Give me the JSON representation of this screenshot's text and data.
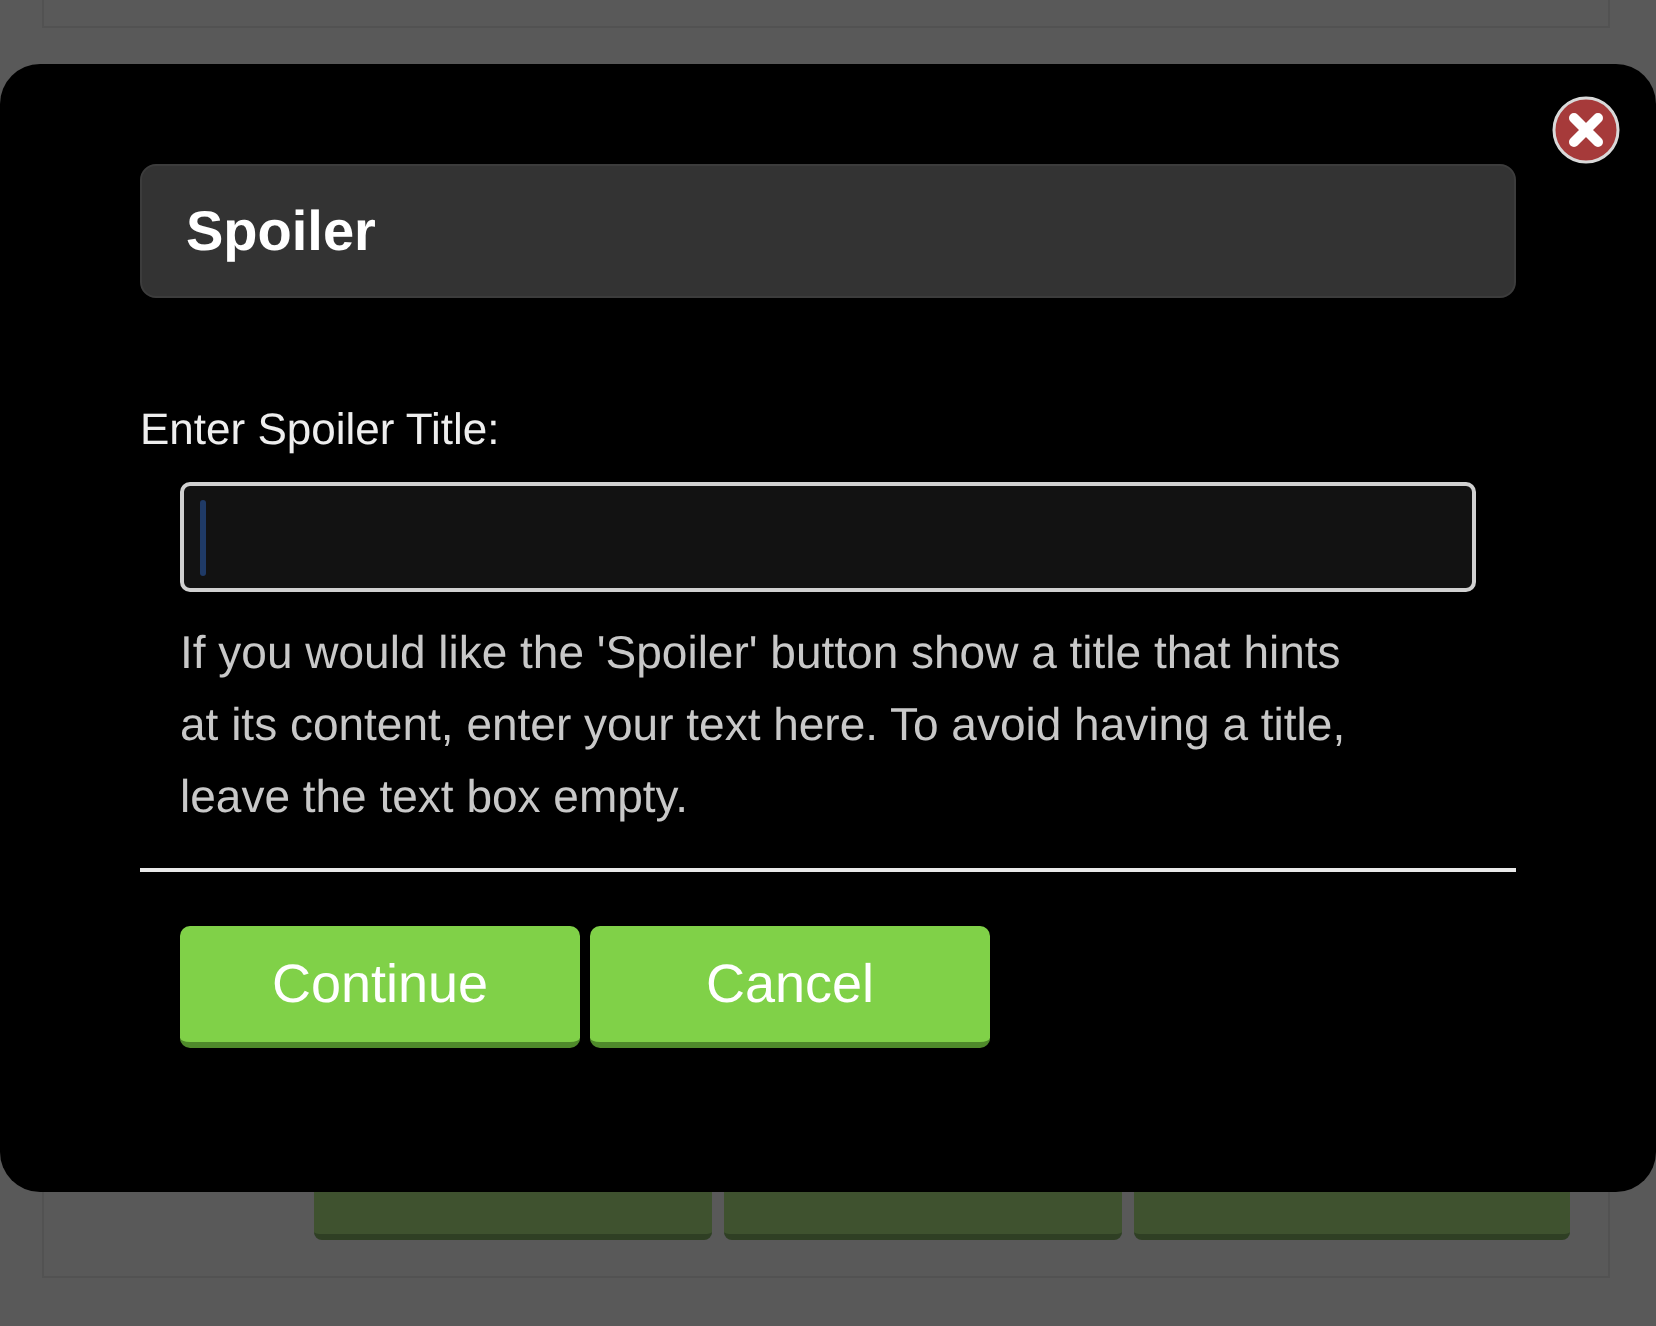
{
  "dialog": {
    "title": "Spoiler",
    "field": {
      "label": "Enter Spoiler Title:",
      "focused": true,
      "help_text": "If you would like the 'Spoiler' button show a title that hints at its content, enter your text here. To avoid having a title, leave the text box empty."
    },
    "buttons": [
      "Continue",
      "Cancel"
    ]
  }
}
